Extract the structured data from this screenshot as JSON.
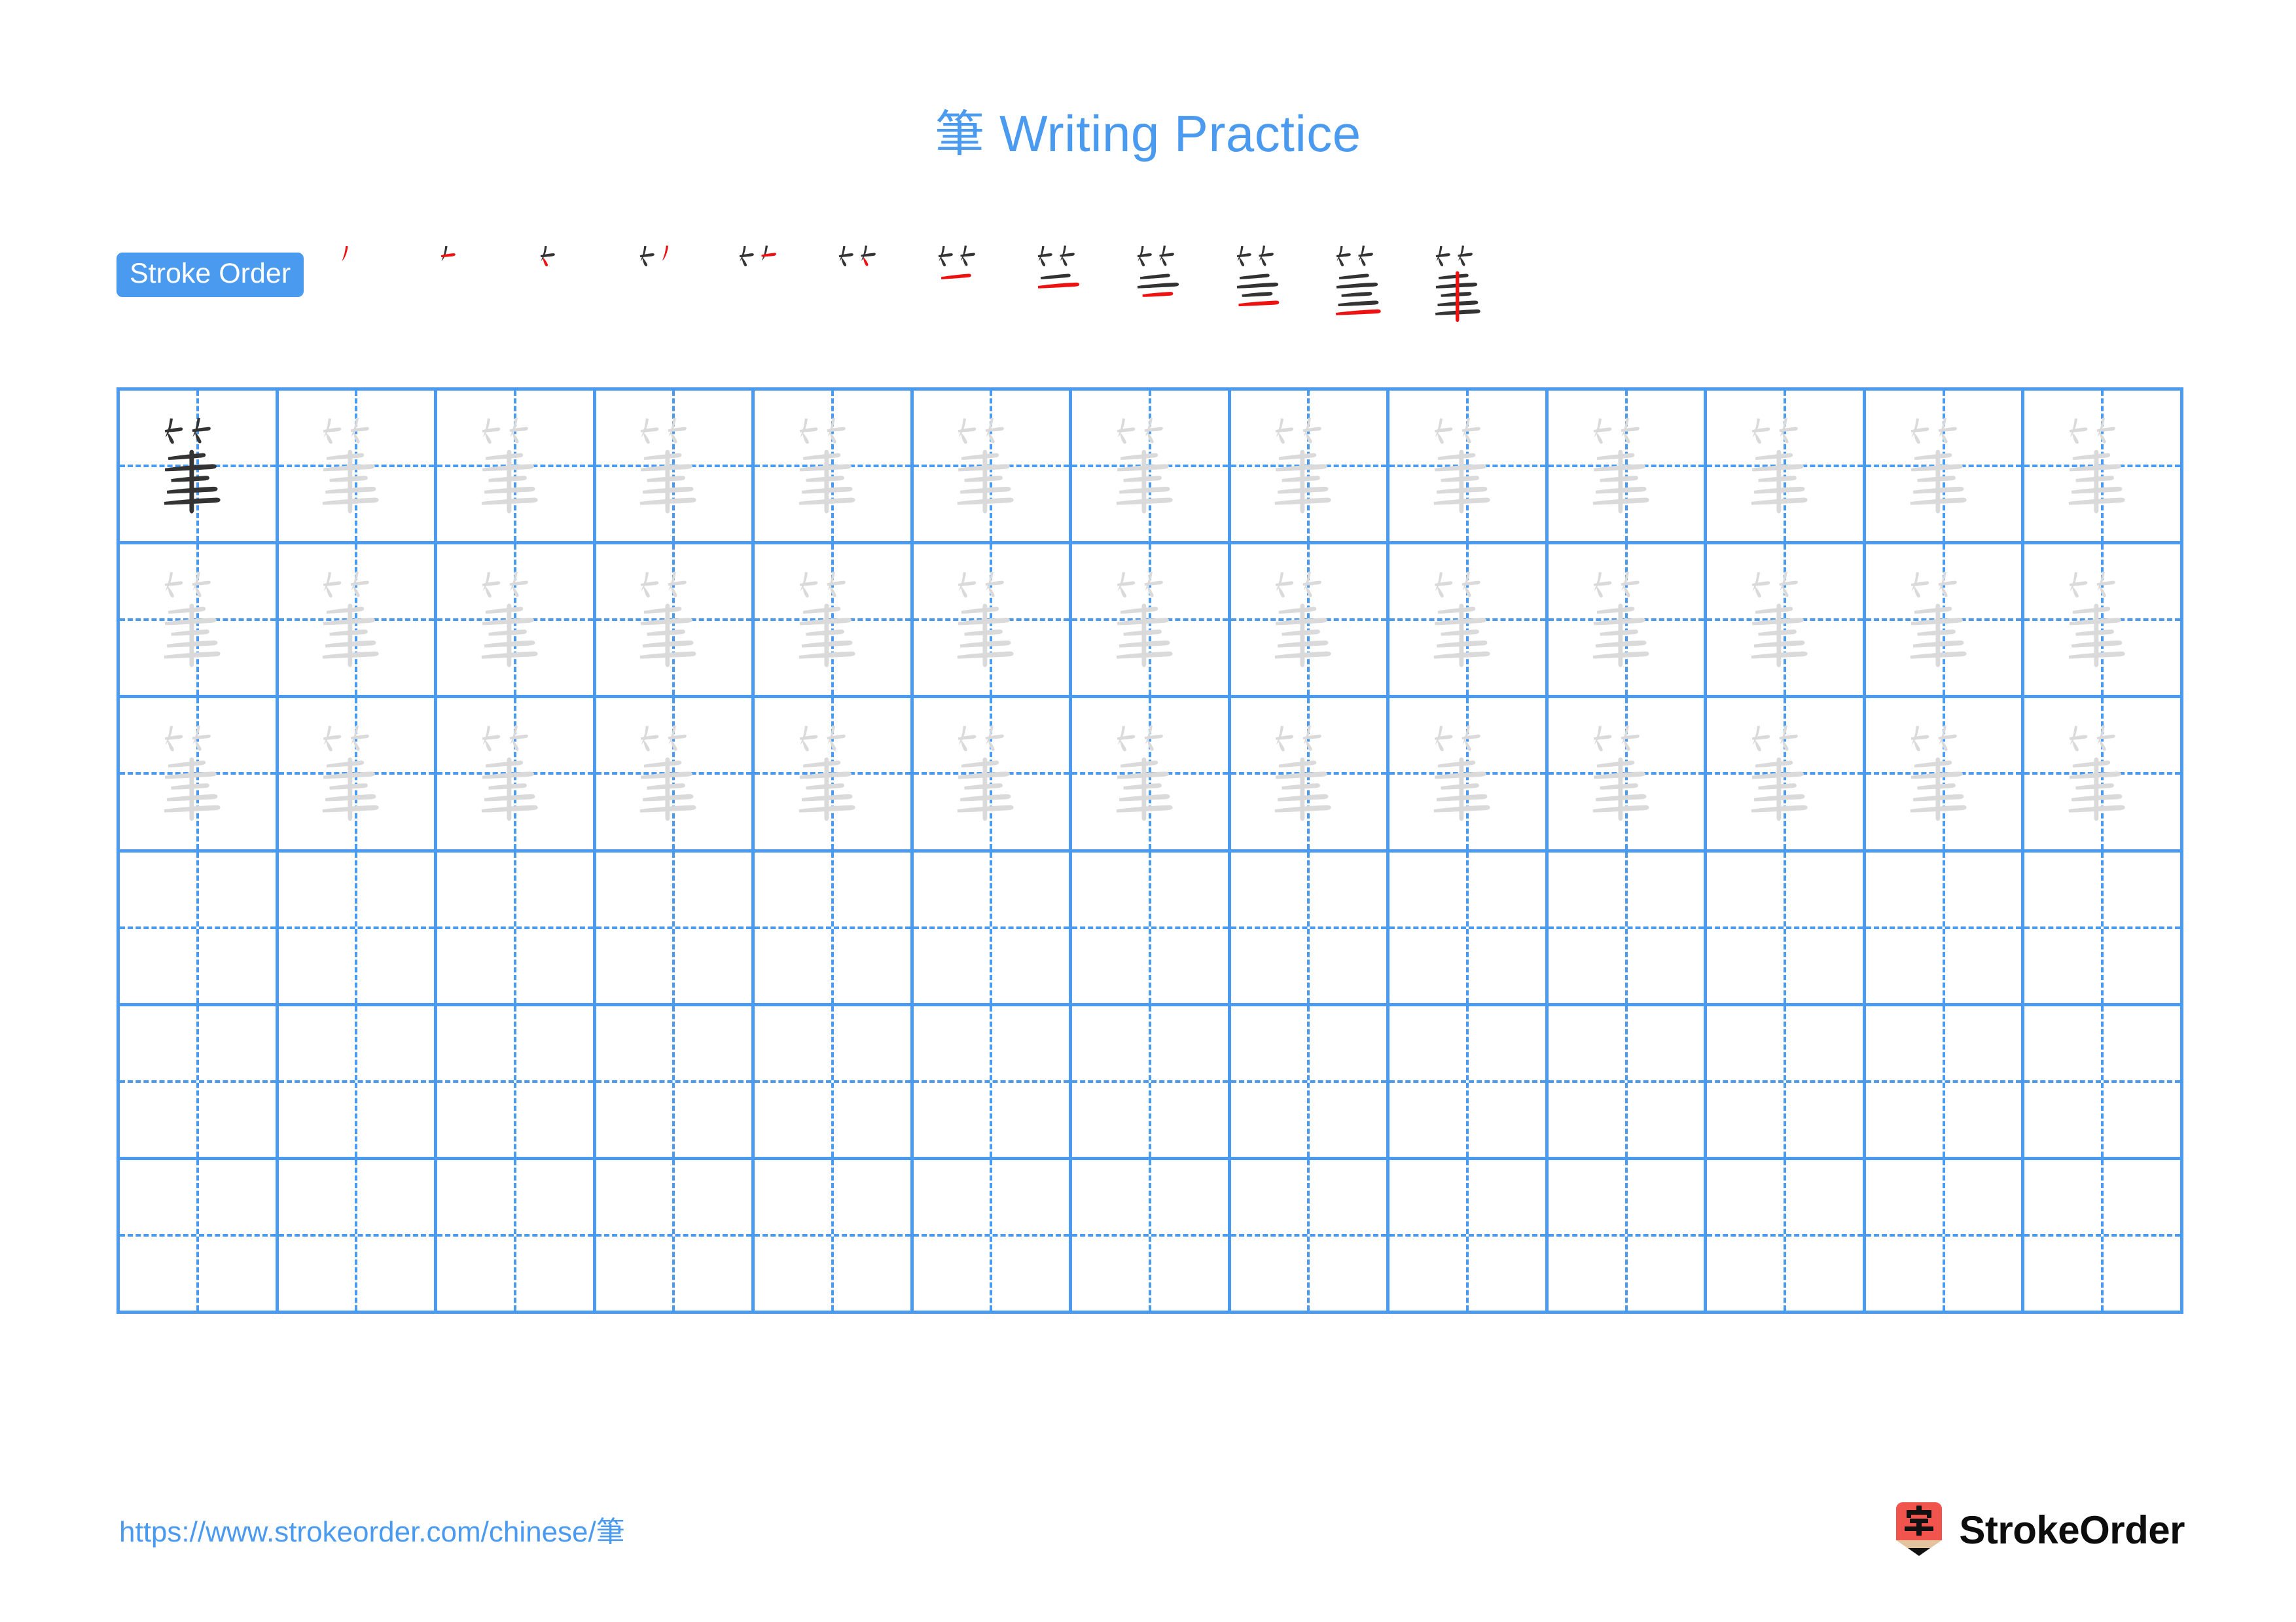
{
  "character": "筆",
  "title": {
    "character": "筆",
    "text": " Writing Practice",
    "full": "筆 Writing Practice",
    "color": "#4a9aef"
  },
  "stroke_order": {
    "badge_label": "Stroke Order",
    "badge_bg": "#4a9aef",
    "badge_text_color": "#ffffff",
    "total_strokes": 12,
    "new_stroke_color": "#ee1111",
    "prior_stroke_color": "#333333",
    "steps": [
      {
        "index": 1,
        "strokes_shown": 1
      },
      {
        "index": 2,
        "strokes_shown": 2
      },
      {
        "index": 3,
        "strokes_shown": 3
      },
      {
        "index": 4,
        "strokes_shown": 4
      },
      {
        "index": 5,
        "strokes_shown": 5
      },
      {
        "index": 6,
        "strokes_shown": 6
      },
      {
        "index": 7,
        "strokes_shown": 7
      },
      {
        "index": 8,
        "strokes_shown": 8
      },
      {
        "index": 9,
        "strokes_shown": 9
      },
      {
        "index": 10,
        "strokes_shown": 10
      },
      {
        "index": 11,
        "strokes_shown": 11
      },
      {
        "index": 12,
        "strokes_shown": 12
      }
    ]
  },
  "grid": {
    "columns": 13,
    "rows": 6,
    "line_color": "#4a9aef",
    "guide_style": "dashed-crosshair",
    "model_char_color": "#333333",
    "trace_char_color": "#dadada",
    "row_fill": [
      {
        "row": 1,
        "first_cell": "model",
        "rest": "trace"
      },
      {
        "row": 2,
        "first_cell": "trace",
        "rest": "trace"
      },
      {
        "row": 3,
        "first_cell": "trace",
        "rest": "trace"
      },
      {
        "row": 4,
        "first_cell": "empty",
        "rest": "empty"
      },
      {
        "row": 5,
        "first_cell": "empty",
        "rest": "empty"
      },
      {
        "row": 6,
        "first_cell": "empty",
        "rest": "empty"
      }
    ]
  },
  "footer": {
    "url_prefix": "https://www.strokeorder.com/chinese/",
    "url_character": "筆",
    "url_full": "https://www.strokeorder.com/chinese/筆",
    "url_color": "#4a9aef",
    "brand_name": "StrokeOrder",
    "brand_icon_char": "字",
    "brand_icon_color": "#f0544c",
    "brand_icon_tip_color": "#e3c39d"
  }
}
